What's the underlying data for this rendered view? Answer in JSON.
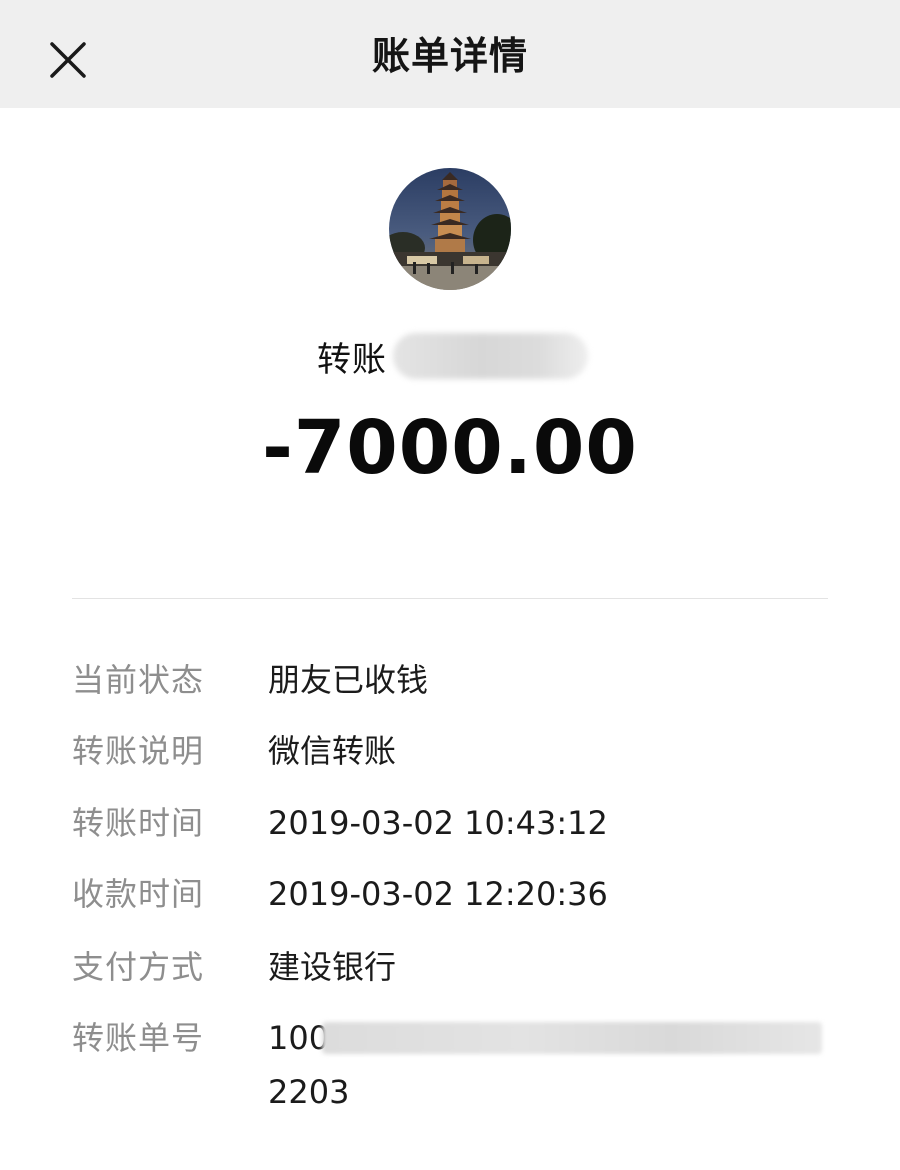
{
  "nav": {
    "title": "账单详情",
    "close_icon": "close-icon"
  },
  "payee": {
    "label": "转账"
  },
  "amount": "-7000.00",
  "details": [
    {
      "label": "当前状态",
      "value": "朋友已收钱"
    },
    {
      "label": "转账说明",
      "value": "微信转账"
    },
    {
      "label": "转账时间",
      "value": "2019-03-02 10:43:12"
    },
    {
      "label": "收款时间",
      "value": "2019-03-02 12:20:36"
    },
    {
      "label": "支付方式",
      "value": "建设银行"
    },
    {
      "label": "转账单号",
      "value": "100",
      "value_line2": "2203"
    }
  ],
  "colors": {
    "nav_background": "#efefef",
    "label_gray": "#8e8e8e",
    "text_dark": "#1b1b1b"
  }
}
